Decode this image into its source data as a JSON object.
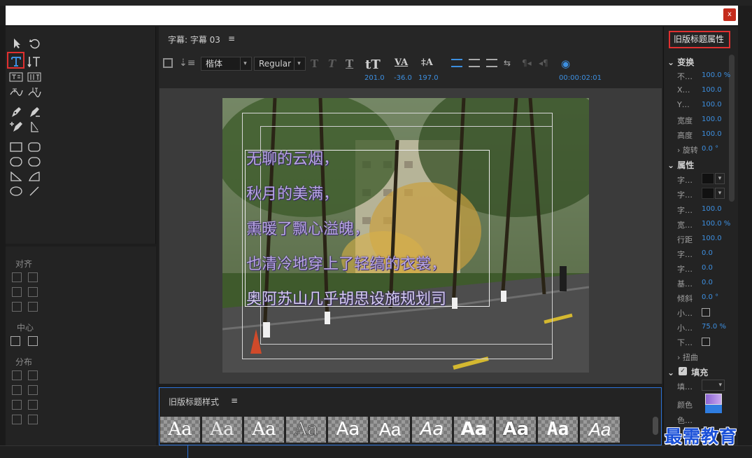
{
  "window": {
    "close_label": "x"
  },
  "center": {
    "panel_title": "字幕: 字幕 03",
    "menu_glyph": "≡",
    "font_family": "楷体",
    "font_style": "Regular",
    "font_size": "201.0",
    "tracking": "-36.0",
    "leading": "197.0",
    "timecode": "00:00:02:01",
    "subtitles": [
      "无聊的云烟，",
      "秋月的美满，",
      "熏暖了飘心溢魄，",
      "也清冷地穿上了轻缟的衣裳，",
      "奥阿苏山几乎胡思设施规划司"
    ]
  },
  "left": {
    "align_label": "对齐",
    "center_label": "中心",
    "distribute_label": "分布"
  },
  "styles": {
    "title": "旧版标题样式",
    "swatch_text": "Aa"
  },
  "right": {
    "title": "旧版标题属性",
    "transform_label": "变换",
    "props": [
      {
        "label": "不…",
        "value": "100.0 %"
      },
      {
        "label": "X…",
        "value": "100.0"
      },
      {
        "label": "Y…",
        "value": "100.0"
      },
      {
        "label": "宽度",
        "value": "100.0"
      },
      {
        "label": "高度",
        "value": "100.0"
      },
      {
        "label": "旋转",
        "value": "0.0 °"
      }
    ],
    "attributes_label": "属性",
    "attr_props": [
      {
        "label": "字…",
        "value": ""
      },
      {
        "label": "字…",
        "value": ""
      },
      {
        "label": "字…",
        "value": "100.0"
      },
      {
        "label": "宽…",
        "value": "100.0 %"
      },
      {
        "label": "行距",
        "value": "100.0"
      },
      {
        "label": "字…",
        "value": "0.0"
      },
      {
        "label": "字…",
        "value": "0.0"
      },
      {
        "label": "基…",
        "value": "0.0"
      },
      {
        "label": "倾斜",
        "value": "0.0 °"
      },
      {
        "label": "小…",
        "value": ""
      },
      {
        "label": "小…",
        "value": "75.0 %"
      },
      {
        "label": "下…",
        "value": ""
      }
    ],
    "distort_label": "扭曲",
    "fill_label": "填充",
    "fill_props": [
      {
        "label": "填…"
      },
      {
        "label": "颜色"
      },
      {
        "label": "色…"
      }
    ]
  },
  "watermark": "最需教育",
  "colors": {
    "accent": "#3d8fe0",
    "highlight": "#e03030",
    "subtitle": "#b9a6e4"
  }
}
